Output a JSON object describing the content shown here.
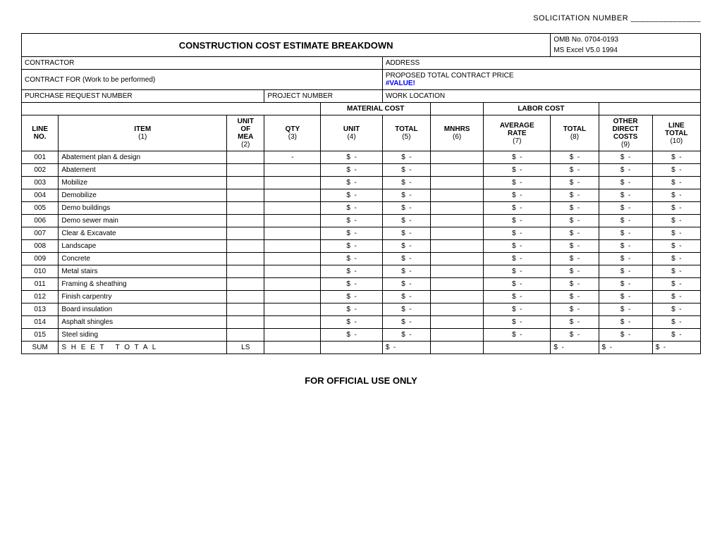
{
  "solicitation": {
    "label": "SOLICITATION NUMBER _______________"
  },
  "form": {
    "title": "CONSTRUCTION COST ESTIMATE BREAKDOWN",
    "omb": "OMB No. 0704-0193",
    "excel_version": "MS Excel V5.0 1994",
    "contractor_label": "CONTRACTOR",
    "address_label": "ADDRESS",
    "contract_for_label": "CONTRACT FOR (Work to be performed)",
    "proposed_label": "PROPOSED TOTAL CONTRACT PRICE",
    "proposed_value": "#VALUE!",
    "purchase_request_label": "PURCHASE REQUEST NUMBER",
    "project_number_label": "PROJECT NUMBER",
    "work_location_label": "WORK LOCATION",
    "material_cost_label": "MATERIAL COST",
    "labor_cost_label": "LABOR COST",
    "col_headers": {
      "line_no": "LINE NO.",
      "item": "ITEM",
      "unit_mea": "UNIT OF MEA",
      "qty": "QTY",
      "unit": "UNIT",
      "total": "TOTAL",
      "mnhrs": "MNHRS",
      "avg_rate": "AVERAGE RATE",
      "labor_total": "TOTAL",
      "other_direct": "OTHER DIRECT COSTS",
      "line_total": "LINE TOTAL"
    },
    "col_sub": {
      "item": "(1)",
      "unit_mea": "(2)",
      "qty": "(3)",
      "unit": "(4)",
      "total": "(5)",
      "mnhrs": "(6)",
      "avg_rate": "(7)",
      "labor_total": "(8)",
      "other_direct": "(9)",
      "line_total": "(10)"
    },
    "rows": [
      {
        "line": "001",
        "item": "Abatement plan & design"
      },
      {
        "line": "002",
        "item": "Abatement"
      },
      {
        "line": "003",
        "item": "Mobilize"
      },
      {
        "line": "004",
        "item": "Demobilize"
      },
      {
        "line": "005",
        "item": "Demo buildings"
      },
      {
        "line": "006",
        "item": "Demo sewer main"
      },
      {
        "line": "007",
        "item": "Clear & Excavate"
      },
      {
        "line": "008",
        "item": "Landscape"
      },
      {
        "line": "009",
        "item": "Concrete"
      },
      {
        "line": "010",
        "item": "Metal stairs"
      },
      {
        "line": "011",
        "item": "Framing & sheathing"
      },
      {
        "line": "012",
        "item": "Finish carpentry"
      },
      {
        "line": "013",
        "item": "Board insulation"
      },
      {
        "line": "014",
        "item": "Asphalt shingles"
      },
      {
        "line": "015",
        "item": "Steel siding"
      }
    ],
    "sum_row": {
      "label": "SUM",
      "item": "S H E E T  T O T A L",
      "unit": "LS"
    },
    "footer": "FOR OFFICIAL USE ONLY"
  }
}
